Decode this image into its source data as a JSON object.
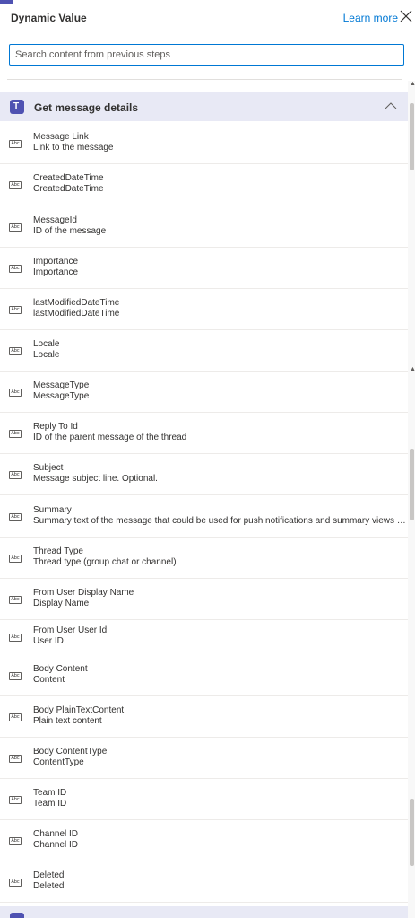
{
  "header": {
    "title": "Dynamic Value",
    "learn_more": "Learn more"
  },
  "search": {
    "placeholder": "Search content from previous steps",
    "value": ""
  },
  "section": {
    "title": "Get message details",
    "icon": "teams-icon",
    "expanded": true,
    "accent_color": "#4f52b2"
  },
  "item_type_icon": "Abc",
  "items": [
    {
      "name": "Message Link",
      "description": "Link to the message"
    },
    {
      "name": "CreatedDateTime",
      "description": "CreatedDateTime"
    },
    {
      "name": "MessageId",
      "description": "ID of the message"
    },
    {
      "name": "Importance",
      "description": "Importance"
    },
    {
      "name": "lastModifiedDateTime",
      "description": "lastModifiedDateTime"
    },
    {
      "name": "Locale",
      "description": "Locale"
    },
    {
      "name": "MessageType",
      "description": "MessageType"
    },
    {
      "name": "Reply To Id",
      "description": "ID of the parent message of the thread"
    },
    {
      "name": "Subject",
      "description": "Message subject line. Optional."
    },
    {
      "name": "Summary",
      "description": "Summary text of the message that could be used for push notifications and summary views o..."
    },
    {
      "name": "Thread Type",
      "description": "Thread type (group chat or channel)"
    },
    {
      "name": "From User Display Name",
      "description": "Display Name"
    },
    {
      "name": "From User User Id",
      "description": "User ID"
    },
    {
      "name": "Body Content",
      "description": "Content"
    },
    {
      "name": "Body PlainTextContent",
      "description": "Plain text content"
    },
    {
      "name": "Body ContentType",
      "description": "ContentType"
    },
    {
      "name": "Team ID",
      "description": "Team ID"
    },
    {
      "name": "Channel ID",
      "description": "Channel ID"
    },
    {
      "name": "Deleted",
      "description": "Deleted"
    }
  ]
}
